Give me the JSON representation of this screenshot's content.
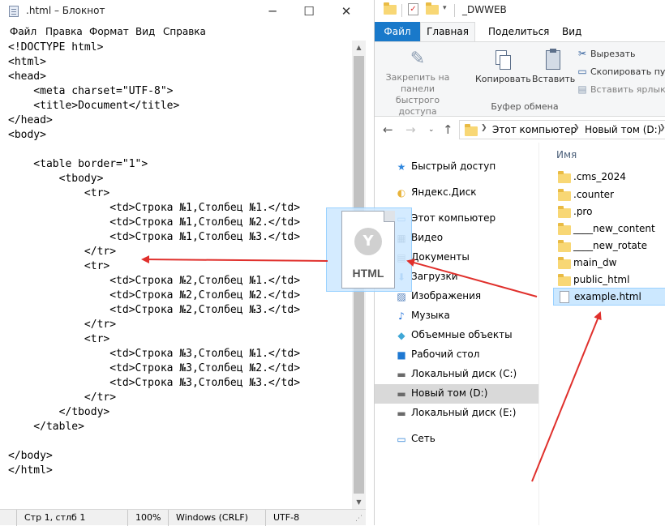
{
  "notepad": {
    "title": ".html – Блокнот",
    "window_buttons": {
      "minimize": "─",
      "maximize": "☐",
      "close": "✕"
    },
    "menu": [
      "Файл",
      "Правка",
      "Формат",
      "Вид",
      "Справка"
    ],
    "content": "<!DOCTYPE html>\n<html>\n<head>\n    <meta charset=\"UTF-8\">\n    <title>Document</title>\n</head>\n<body>\n\n    <table border=\"1\">\n        <tbody>\n            <tr>\n                <td>Строка №1,Столбец №1.</td>\n                <td>Строка №1,Столбец №2.</td>\n                <td>Строка №1,Столбец №3.</td>\n            </tr>\n            <tr>\n                <td>Строка №2,Столбец №1.</td>\n                <td>Строка №2,Столбец №2.</td>\n                <td>Строка №2,Столбец №3.</td>\n            </tr>\n            <tr>\n                <td>Строка №3,Столбец №1.</td>\n                <td>Строка №3,Столбец №2.</td>\n                <td>Строка №3,Столбец №3.</td>\n            </tr>\n        </tbody>\n    </table>\n\n</body>\n</html>",
    "status": {
      "position": "Стр 1, стлб 1",
      "zoom": "100%",
      "line_endings": "Windows (CRLF)",
      "encoding": "UTF-8"
    }
  },
  "explorer": {
    "title": "_DWWEB",
    "ribbon_tabs": [
      "Файл",
      "Главная",
      "Поделиться",
      "Вид"
    ],
    "ribbon": {
      "pin": "Закрепить на панели быстрого доступа",
      "copy": "Копировать",
      "paste": "Вставить",
      "cut": "Вырезать",
      "copy_path": "Скопировать пут",
      "paste_shortcut": "Вставить ярлык",
      "group_label": "Буфер обмена"
    },
    "address": {
      "pc": "Этот компьютер",
      "volume": "Новый том (D:)"
    },
    "nav_pane": [
      {
        "label": "Быстрый доступ",
        "icon": "star-icon"
      },
      {
        "label": "Яндекс.Диск",
        "icon": "yandex-disk-icon"
      },
      {
        "label": "Этот компьютер",
        "icon": "computer-icon"
      },
      {
        "label": "Видео",
        "icon": "video-icon"
      },
      {
        "label": "Документы",
        "icon": "documents-icon"
      },
      {
        "label": "Загрузки",
        "icon": "downloads-icon"
      },
      {
        "label": "Изображения",
        "icon": "images-icon"
      },
      {
        "label": "Музыка",
        "icon": "music-icon"
      },
      {
        "label": "Объемные объекты",
        "icon": "3d-objects-icon"
      },
      {
        "label": "Рабочий стол",
        "icon": "desktop-icon"
      },
      {
        "label": "Локальный диск (C:)",
        "icon": "drive-icon"
      },
      {
        "label": "Новый том (D:)",
        "icon": "drive-icon"
      },
      {
        "label": "Локальный диск (E:)",
        "icon": "drive-icon"
      },
      {
        "label": "Сеть",
        "icon": "network-icon"
      }
    ],
    "column_header": "Имя",
    "files": [
      ".cms_2024",
      ".counter",
      ".pro",
      "____new_content",
      "____new_rotate",
      "main_dw",
      "public_html",
      "example.html"
    ]
  },
  "drag_ghost": {
    "label": "HTML"
  },
  "colors": {
    "annotation_arrow": "#e0302c",
    "ribbon_file_tab": "#1979ca",
    "selection": "#cce8ff"
  }
}
